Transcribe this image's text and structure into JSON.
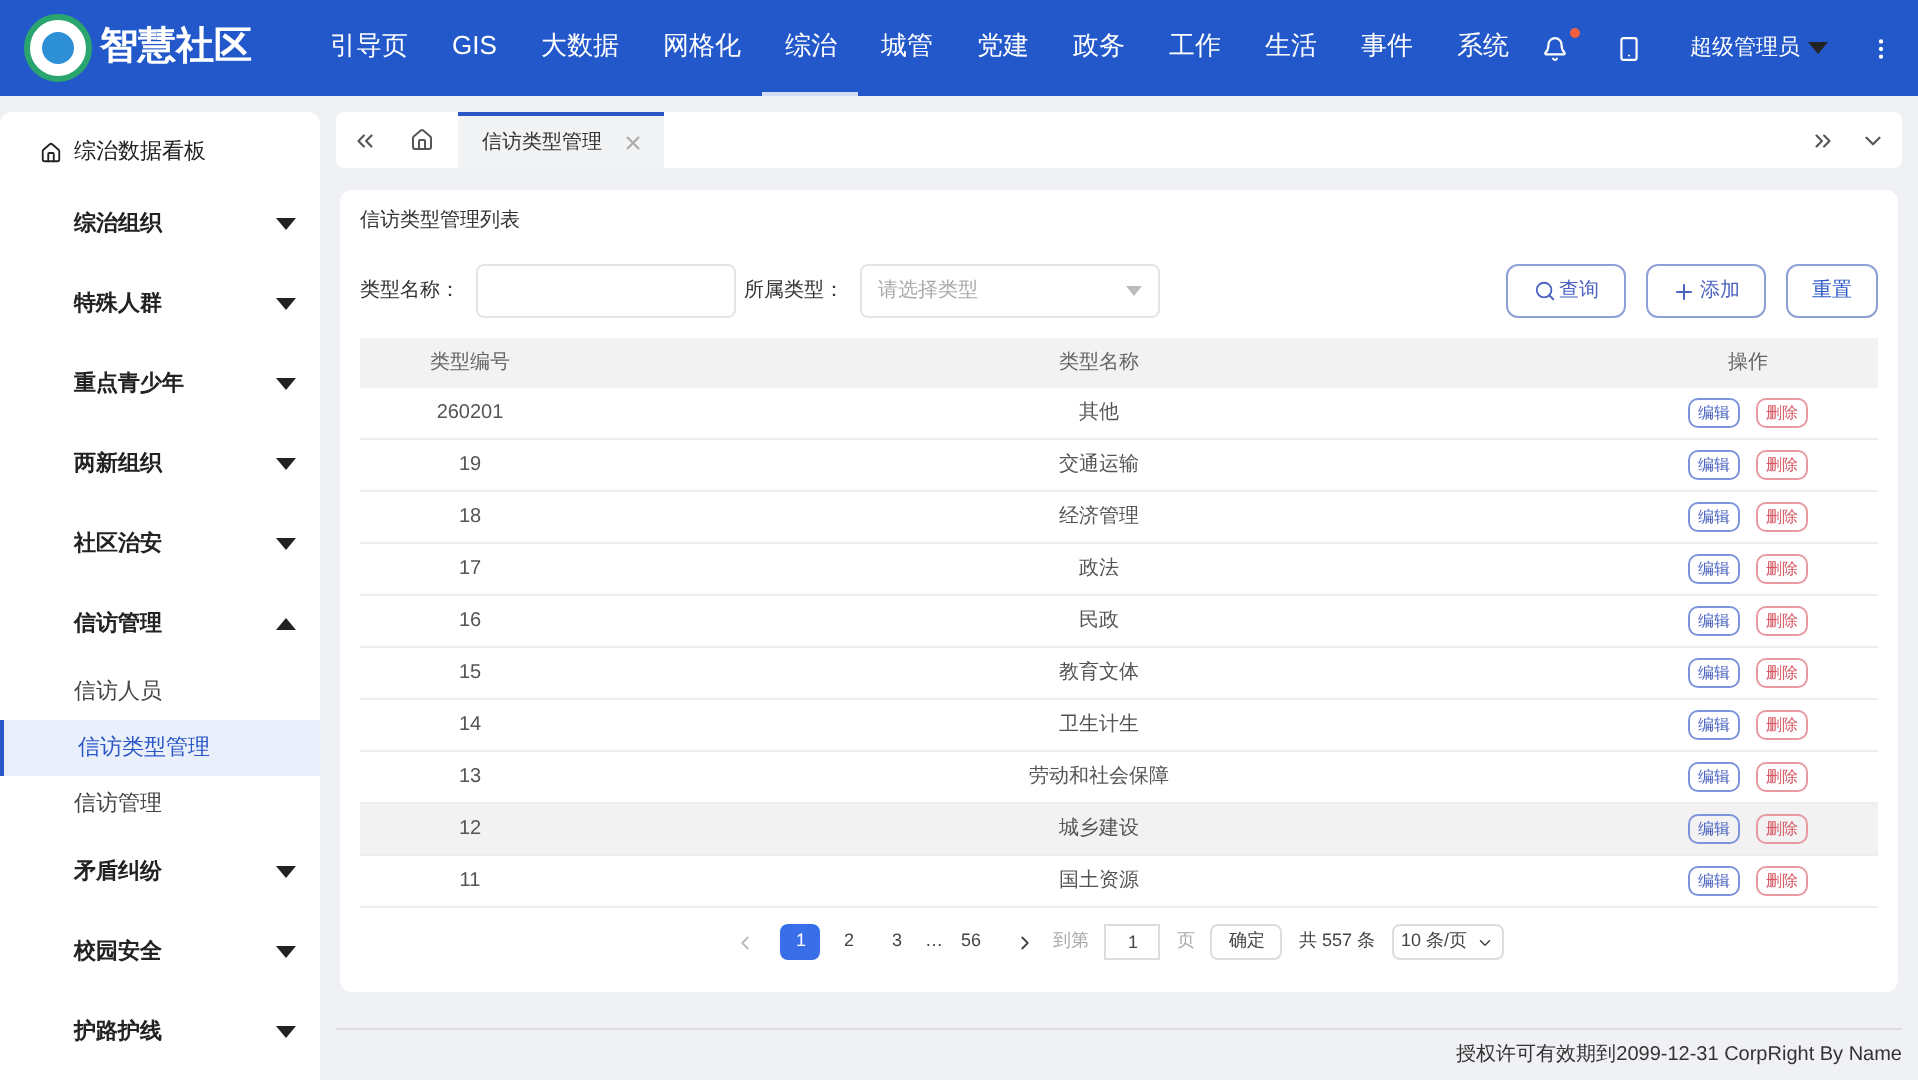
{
  "header": {
    "logo_text": "智慧社区",
    "nav": [
      {
        "label": "引导页",
        "selected": false
      },
      {
        "label": "GIS",
        "selected": false
      },
      {
        "label": "大数据",
        "selected": false
      },
      {
        "label": "网格化",
        "selected": false
      },
      {
        "label": "综治",
        "selected": true
      },
      {
        "label": "城管",
        "selected": false
      },
      {
        "label": "党建",
        "selected": false
      },
      {
        "label": "政务",
        "selected": false
      },
      {
        "label": "工作",
        "selected": false
      },
      {
        "label": "生活",
        "selected": false
      },
      {
        "label": "事件",
        "selected": false
      },
      {
        "label": "系统",
        "selected": false
      }
    ],
    "notification_dot": true,
    "user": "超级管理员"
  },
  "sidebar": {
    "items": [
      {
        "kind": "link",
        "label": "综治数据看板"
      },
      {
        "kind": "group",
        "label": "综治组织",
        "expanded": false
      },
      {
        "kind": "group",
        "label": "特殊人群",
        "expanded": false
      },
      {
        "kind": "group",
        "label": "重点青少年",
        "expanded": false
      },
      {
        "kind": "group",
        "label": "两新组织",
        "expanded": false
      },
      {
        "kind": "group",
        "label": "社区治安",
        "expanded": false
      },
      {
        "kind": "group",
        "label": "信访管理",
        "expanded": true,
        "children": [
          {
            "label": "信访人员",
            "selected": false
          },
          {
            "label": "信访类型管理",
            "selected": true
          },
          {
            "label": "信访管理",
            "selected": false
          }
        ]
      },
      {
        "kind": "group",
        "label": "矛盾纠纷",
        "expanded": false
      },
      {
        "kind": "group",
        "label": "校园安全",
        "expanded": false
      },
      {
        "kind": "group",
        "label": "护路护线",
        "expanded": false
      }
    ]
  },
  "tabs": [
    {
      "label": "信访类型管理",
      "selected": true
    }
  ],
  "panel": {
    "title": "信访类型管理列表",
    "filters": [
      {
        "label": "类型名称：",
        "kind": "input"
      },
      {
        "label": "所属类型：",
        "kind": "select",
        "placeholder": "请选择类型"
      }
    ],
    "buttons": [
      {
        "kind": "search",
        "label": "查询"
      },
      {
        "kind": "add",
        "label": "添加"
      },
      {
        "kind": "plain",
        "label": "重置"
      }
    ],
    "table": {
      "columns": [
        "类型编号",
        "类型名称",
        "操作"
      ],
      "rows": [
        {
          "id": "260201",
          "name": "其他",
          "hovered": false,
          "actions": [
            "编辑",
            "删除"
          ]
        },
        {
          "id": "19",
          "name": "交通运输",
          "hovered": false,
          "actions": [
            "编辑",
            "删除"
          ]
        },
        {
          "id": "18",
          "name": "经济管理",
          "hovered": false,
          "actions": [
            "编辑",
            "删除"
          ]
        },
        {
          "id": "17",
          "name": "政法",
          "hovered": false,
          "actions": [
            "编辑",
            "删除"
          ]
        },
        {
          "id": "16",
          "name": "民政",
          "hovered": false,
          "actions": [
            "编辑",
            "删除"
          ]
        },
        {
          "id": "15",
          "name": "教育文体",
          "hovered": false,
          "actions": [
            "编辑",
            "删除"
          ]
        },
        {
          "id": "14",
          "name": "卫生计生",
          "hovered": false,
          "actions": [
            "编辑",
            "删除"
          ]
        },
        {
          "id": "13",
          "name": "劳动和社会保障",
          "hovered": false,
          "actions": [
            "编辑",
            "删除"
          ]
        },
        {
          "id": "12",
          "name": "城乡建设",
          "hovered": true,
          "actions": [
            "编辑",
            "删除"
          ]
        },
        {
          "id": "11",
          "name": "国土资源",
          "hovered": false,
          "actions": [
            "编辑",
            "删除"
          ]
        }
      ]
    },
    "pagination": {
      "pages": [
        {
          "label": "1",
          "selected": true
        },
        {
          "label": "2",
          "selected": false
        },
        {
          "label": "3",
          "selected": false
        },
        {
          "label": "…",
          "kind": "ellipsis"
        },
        {
          "label": "56",
          "selected": false
        }
      ],
      "goto_label": "到第",
      "goto_value": "1",
      "page_unit": "页",
      "confirm": "确定",
      "total": "共 557 条",
      "page_size": "10 条/页"
    }
  },
  "footer": "授权许可有效期到2099-12-31 CorpRight By Name"
}
